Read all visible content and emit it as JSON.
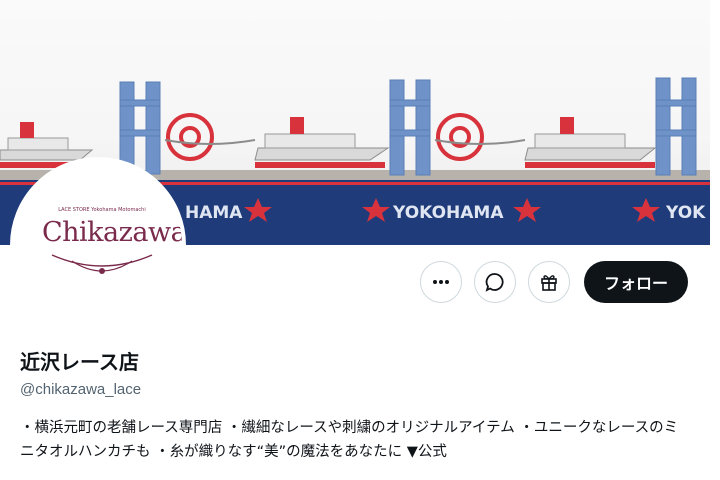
{
  "banner": {
    "texts": [
      "HAMA",
      "YOKOHAMA",
      "YOK"
    ],
    "colors": {
      "sky": "#f6f6f6",
      "navy": "#1f3b7a",
      "red": "#d8333c",
      "blue": "#6f93c8",
      "grey": "#9a9a9a"
    }
  },
  "avatar": {
    "logo_text": "Chikazawa",
    "logo_subtext": "LACE STORE Yokohama Motomachi"
  },
  "actions": {
    "more_icon": "more-horizontal-icon",
    "message_icon": "message-bubble-icon",
    "gift_icon": "gift-icon",
    "follow_label": "フォロー"
  },
  "profile": {
    "name": "近沢レース店",
    "handle": "@chikazawa_lace",
    "bio": "・横浜元町の老舗レース専門店 ・繊細なレースや刺繍のオリジナルアイテム ・ユニークなレースのミニタオルハンカチも ・糸が織りなす“美”の魔法をあなたに ▼公式"
  }
}
